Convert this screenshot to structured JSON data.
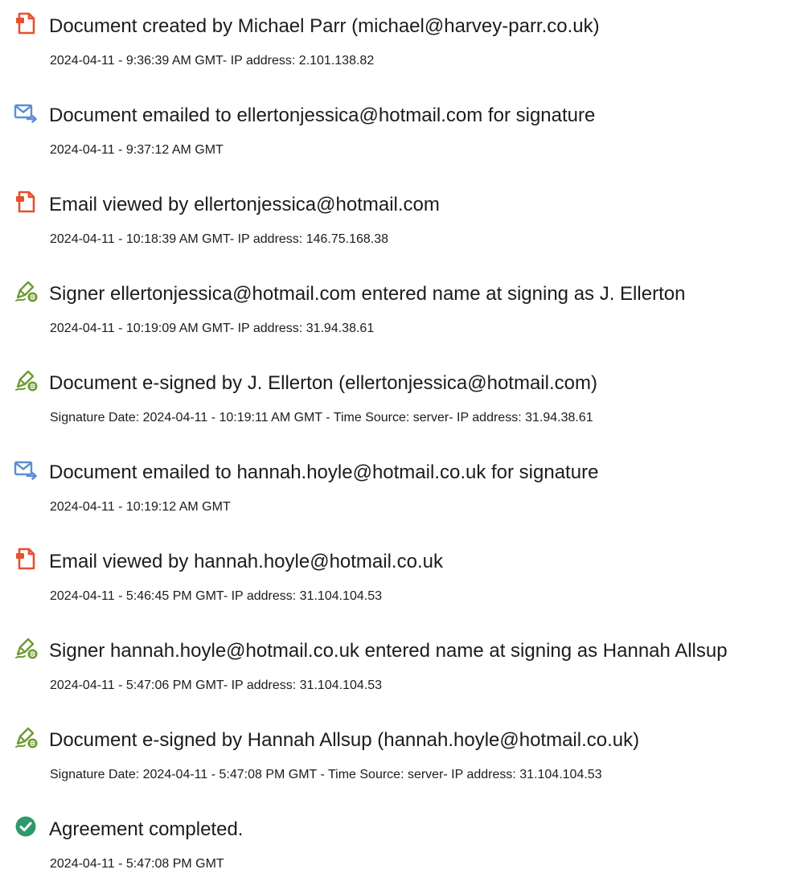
{
  "events": [
    {
      "icon": "document-created-icon",
      "title": "Document created by Michael Parr (michael@harvey-parr.co.uk)",
      "detail": "2024-04-11 - 9:36:39 AM GMT- IP address: 2.101.138.82"
    },
    {
      "icon": "email-sent-icon",
      "title": "Document emailed to ellertonjessica@hotmail.com for signature",
      "detail": "2024-04-11 - 9:37:12 AM GMT"
    },
    {
      "icon": "document-viewed-icon",
      "title": "Email viewed by ellertonjessica@hotmail.com",
      "detail": "2024-04-11 - 10:18:39 AM GMT- IP address: 146.75.168.38"
    },
    {
      "icon": "pen-signature-icon",
      "title": "Signer ellertonjessica@hotmail.com entered name at signing as J. Ellerton",
      "detail": "2024-04-11 - 10:19:09 AM GMT- IP address: 31.94.38.61"
    },
    {
      "icon": "pen-signature-icon",
      "title": "Document e-signed by J. Ellerton (ellertonjessica@hotmail.com)",
      "detail": "Signature Date: 2024-04-11 - 10:19:11 AM GMT - Time Source: server- IP address: 31.94.38.61"
    },
    {
      "icon": "email-sent-icon",
      "title": "Document emailed to hannah.hoyle@hotmail.co.uk for signature",
      "detail": "2024-04-11 - 10:19:12 AM GMT"
    },
    {
      "icon": "document-viewed-icon",
      "title": "Email viewed by hannah.hoyle@hotmail.co.uk",
      "detail": "2024-04-11 - 5:46:45 PM GMT- IP address: 31.104.104.53"
    },
    {
      "icon": "pen-signature-icon",
      "title": "Signer hannah.hoyle@hotmail.co.uk entered name at signing as Hannah Allsup",
      "detail": "2024-04-11 - 5:47:06 PM GMT- IP address: 31.104.104.53"
    },
    {
      "icon": "pen-signature-icon",
      "title": "Document e-signed by Hannah Allsup (hannah.hoyle@hotmail.co.uk)",
      "detail": "Signature Date: 2024-04-11 - 5:47:08 PM GMT - Time Source: server- IP address: 31.104.104.53"
    },
    {
      "icon": "check-circle-icon",
      "title": "Agreement completed.",
      "detail": "2024-04-11 - 5:47:08 PM GMT"
    }
  ],
  "colors": {
    "document_icon": "#e8502e",
    "email_icon": "#5a8fd6",
    "pen_icon": "#6b9b2f",
    "check_icon": "#2e9a6a",
    "text": "#1c1c1c"
  }
}
